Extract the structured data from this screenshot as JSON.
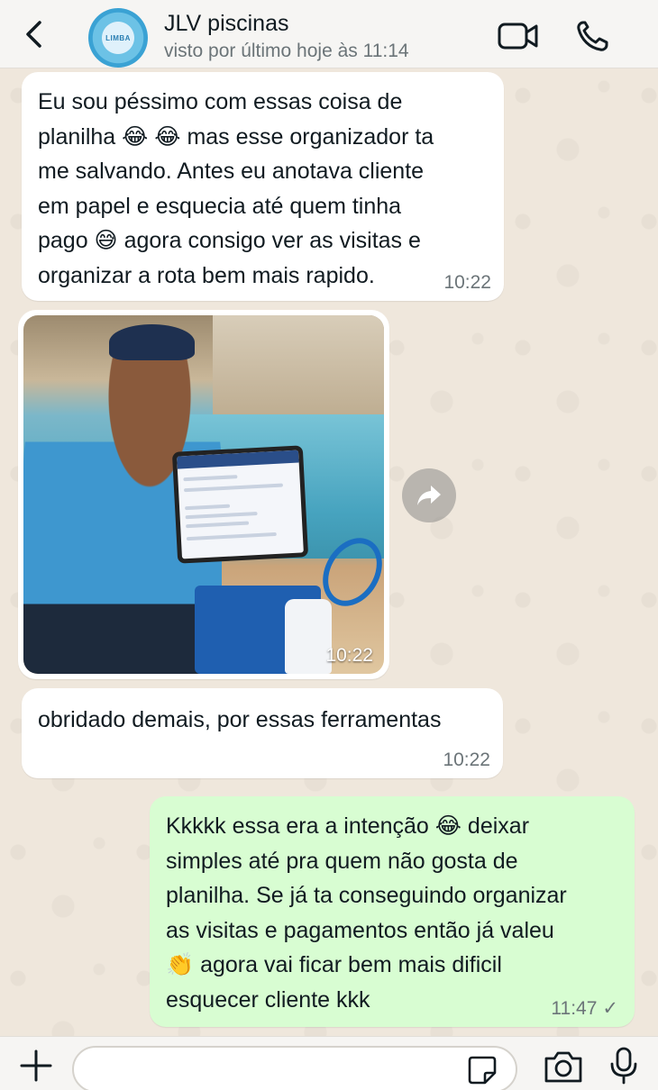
{
  "header": {
    "back_icon": "chevron-left-icon",
    "avatar_label": "LIMBA",
    "contact_name": "JLV piscinas",
    "status": "visto por último hoje às 11:14",
    "video_icon": "video-camera-icon",
    "phone_icon": "phone-icon"
  },
  "messages": [
    {
      "direction": "incoming",
      "lines": [
        "Eu sou péssimo com essas coisa de",
        "planilha 😂 😂 mas esse organizador ta",
        "me salvando. Antes eu anotava cliente",
        "em papel e esquecia até quem tinha",
        "pago 😅 agora consigo ver as visitas e",
        "organizar a rota bem mais rapido."
      ],
      "time": "10:22"
    },
    {
      "direction": "incoming",
      "type": "image",
      "time": "10:22",
      "forward_icon": "forward-arrow-icon"
    },
    {
      "direction": "incoming",
      "lines": [
        "obridado demais, por essas ferramentas"
      ],
      "time": "10:22"
    },
    {
      "direction": "outgoing",
      "lines": [
        "Kkkkk essa era a intenção 😂 deixar",
        "simples até pra quem não gosta de",
        "planilha. Se já ta conseguindo organizar",
        "as visitas e pagamentos então já valeu",
        "👏 agora vai ficar bem mais dificil",
        "esquecer cliente kkk"
      ],
      "time": "11:47",
      "status": "✓"
    }
  ],
  "composer": {
    "value": "",
    "plus_icon": "plus-icon",
    "sticker_icon": "sticker-icon",
    "camera_icon": "camera-icon",
    "mic_icon": "microphone-icon"
  },
  "colors": {
    "incoming_bubble": "#ffffff",
    "outgoing_bubble": "#d8fdd2",
    "chat_background": "#efe7dc",
    "header_background": "#f6f5f3"
  }
}
